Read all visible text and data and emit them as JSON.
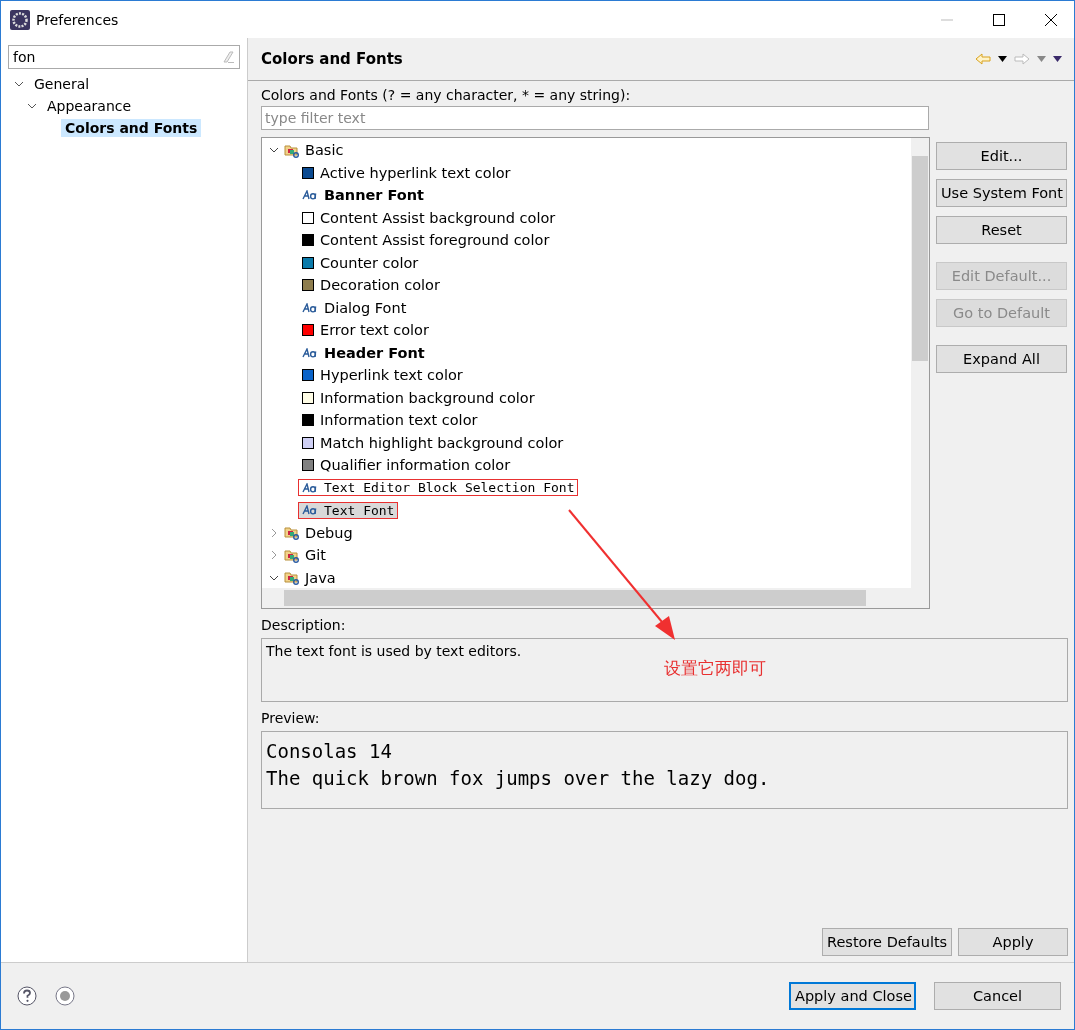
{
  "window": {
    "title": "Preferences"
  },
  "sidebar": {
    "filter": {
      "value": "fon"
    },
    "tree": [
      {
        "label": "General",
        "expanded": true,
        "selected": false,
        "children": [
          {
            "label": "Appearance",
            "expanded": true,
            "selected": false,
            "children": [
              {
                "label": "Colors and Fonts",
                "selected": true
              }
            ]
          }
        ]
      }
    ]
  },
  "page": {
    "title": "Colors and Fonts",
    "list_label": "Colors and Fonts (? = any character, * = any string):",
    "filter": {
      "placeholder": "type filter text"
    },
    "tree": [
      {
        "label": "Basic",
        "expanded": true,
        "children": [
          {
            "label": "Active hyperlink text color",
            "kind": "color",
            "color": "#0b4a91",
            "selected": false,
            "marked": false
          },
          {
            "label": "Banner Font",
            "kind": "bold-font",
            "selected": false,
            "marked": false
          },
          {
            "label": "Content Assist background color",
            "kind": "color",
            "color": "#ffffff",
            "selected": false,
            "marked": false
          },
          {
            "label": "Content Assist foreground color",
            "kind": "color",
            "color": "#000000",
            "selected": false,
            "marked": false
          },
          {
            "label": "Counter color",
            "kind": "color",
            "color": "#0a7aaa",
            "selected": false,
            "marked": false
          },
          {
            "label": "Decoration color",
            "kind": "color",
            "color": "#8e7d4e",
            "selected": false,
            "marked": false
          },
          {
            "label": "Dialog Font",
            "kind": "font",
            "selected": false,
            "marked": false
          },
          {
            "label": "Error text color",
            "kind": "color",
            "color": "#ff0000",
            "selected": false,
            "marked": false
          },
          {
            "label": "Header Font",
            "kind": "bold-font",
            "selected": false,
            "marked": false
          },
          {
            "label": "Hyperlink text color",
            "kind": "color",
            "color": "#0a63c9",
            "selected": false,
            "marked": false
          },
          {
            "label": "Information background color",
            "kind": "color",
            "color": "#fffde6",
            "selected": false,
            "marked": false
          },
          {
            "label": "Information text color",
            "kind": "color",
            "color": "#000000",
            "selected": false,
            "marked": false
          },
          {
            "label": "Match highlight background color",
            "kind": "color",
            "color": "#cfd0f5",
            "selected": false,
            "marked": false
          },
          {
            "label": "Qualifier information color",
            "kind": "color",
            "color": "#808080",
            "selected": false,
            "marked": false
          },
          {
            "label": "Text Editor Block Selection Font",
            "kind": "mono-font",
            "selected": false,
            "marked": true
          },
          {
            "label": "Text Font",
            "kind": "mono-font",
            "selected": true,
            "marked": true
          }
        ]
      },
      {
        "label": "Debug",
        "expanded": false
      },
      {
        "label": "Git",
        "expanded": false
      },
      {
        "label": "Java",
        "expanded": true
      }
    ],
    "buttons": [
      {
        "label": "Edit...",
        "disabled": false
      },
      {
        "label": "Use System Font",
        "disabled": false
      },
      {
        "label": "Reset",
        "disabled": false
      },
      {
        "label": "Edit Default...",
        "disabled": true
      },
      {
        "label": "Go to Default",
        "disabled": true
      },
      {
        "label": "Expand All",
        "disabled": false
      }
    ],
    "description_label": "Description:",
    "description": "The text font is used by text editors.",
    "annotation": "设置它两即可",
    "preview_label": "Preview:",
    "preview": [
      "Consolas 14",
      "The quick brown fox jumps over the lazy dog."
    ],
    "page_buttons": [
      "Restore Defaults",
      "Apply"
    ]
  },
  "footer": {
    "buttons": [
      {
        "label": "Apply and Close",
        "default": true
      },
      {
        "label": "Cancel",
        "default": false
      }
    ]
  }
}
